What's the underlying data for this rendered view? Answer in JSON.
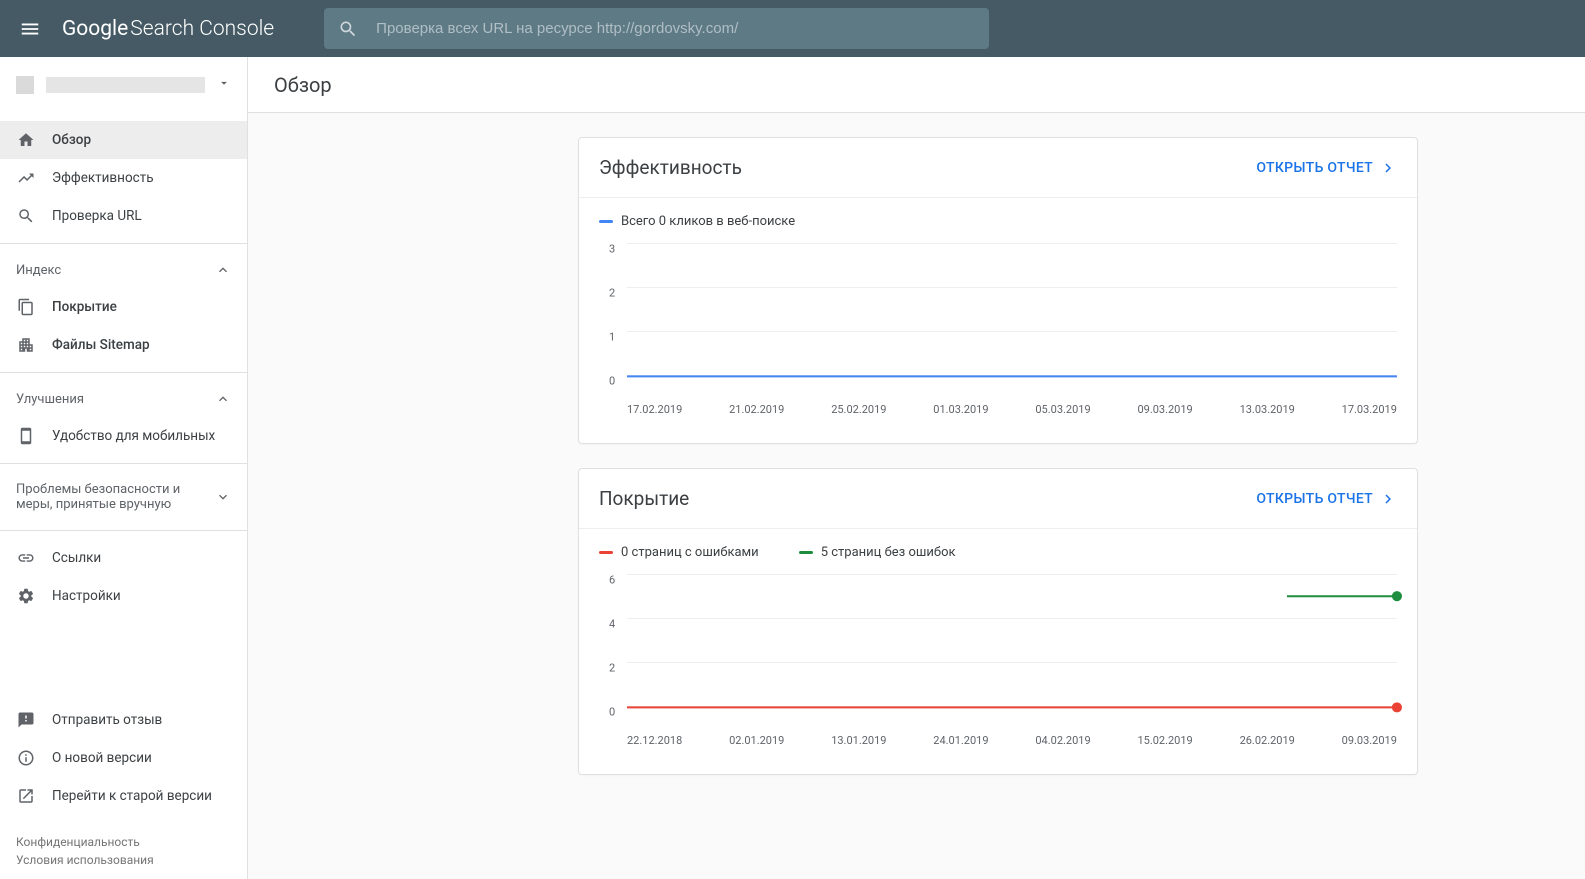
{
  "header": {
    "logo_google": "Google",
    "logo_rest": "Search Console",
    "search_placeholder": "Проверка всех URL на ресурсе http://gordovsky.com/"
  },
  "sidebar": {
    "groups": {
      "index": "Индекс",
      "enhancements": "Улучшения",
      "security": "Проблемы безопасности и меры, принятые вручную"
    },
    "items": {
      "overview": "Обзор",
      "performance": "Эффективность",
      "url_inspection": "Проверка URL",
      "coverage": "Покрытие",
      "sitemaps": "Файлы Sitemap",
      "mobile_usability": "Удобство для мобильных",
      "links": "Ссылки",
      "settings": "Настройки",
      "feedback": "Отправить отзыв",
      "about_new": "О новой версии",
      "old_version": "Перейти к старой версии"
    },
    "footer": {
      "privacy": "Конфиденциальность",
      "terms": "Условия использования"
    }
  },
  "page": {
    "title": "Обзор",
    "open_report": "ОТКРЫТЬ ОТЧЕТ"
  },
  "cards": {
    "performance": {
      "title": "Эффективность",
      "legend": "Всего 0 кликов в веб-поиске"
    },
    "coverage": {
      "title": "Покрытие",
      "legend_errors": "0 страниц с ошибками",
      "legend_valid": "5 страниц без ошибок"
    }
  },
  "chart_data": [
    {
      "type": "line",
      "title": "Эффективность",
      "series": [
        {
          "name": "Всего 0 кликов в веб-поиске",
          "color": "#4285f4",
          "values": [
            0,
            0,
            0,
            0,
            0,
            0,
            0,
            0
          ]
        }
      ],
      "categories": [
        "17.02.2019",
        "21.02.2019",
        "25.02.2019",
        "01.03.2019",
        "05.03.2019",
        "09.03.2019",
        "13.03.2019",
        "17.03.2019"
      ],
      "y_ticks": [
        0,
        1,
        2,
        3
      ],
      "ylim": [
        0,
        3
      ]
    },
    {
      "type": "line",
      "title": "Покрытие",
      "series": [
        {
          "name": "0 страниц с ошибками",
          "color": "#ea4335",
          "values": [
            0,
            0,
            0,
            0,
            0,
            0,
            0,
            0
          ],
          "last_marker": true
        },
        {
          "name": "5 страниц без ошибок",
          "color": "#1e8e3e",
          "values": [
            null,
            null,
            null,
            null,
            null,
            null,
            5,
            5
          ],
          "last_marker": true
        }
      ],
      "categories": [
        "22.12.2018",
        "02.01.2019",
        "13.01.2019",
        "24.01.2019",
        "04.02.2019",
        "15.02.2019",
        "26.02.2019",
        "09.03.2019"
      ],
      "y_ticks": [
        0,
        2,
        4,
        6
      ],
      "ylim": [
        0,
        6
      ]
    }
  ]
}
